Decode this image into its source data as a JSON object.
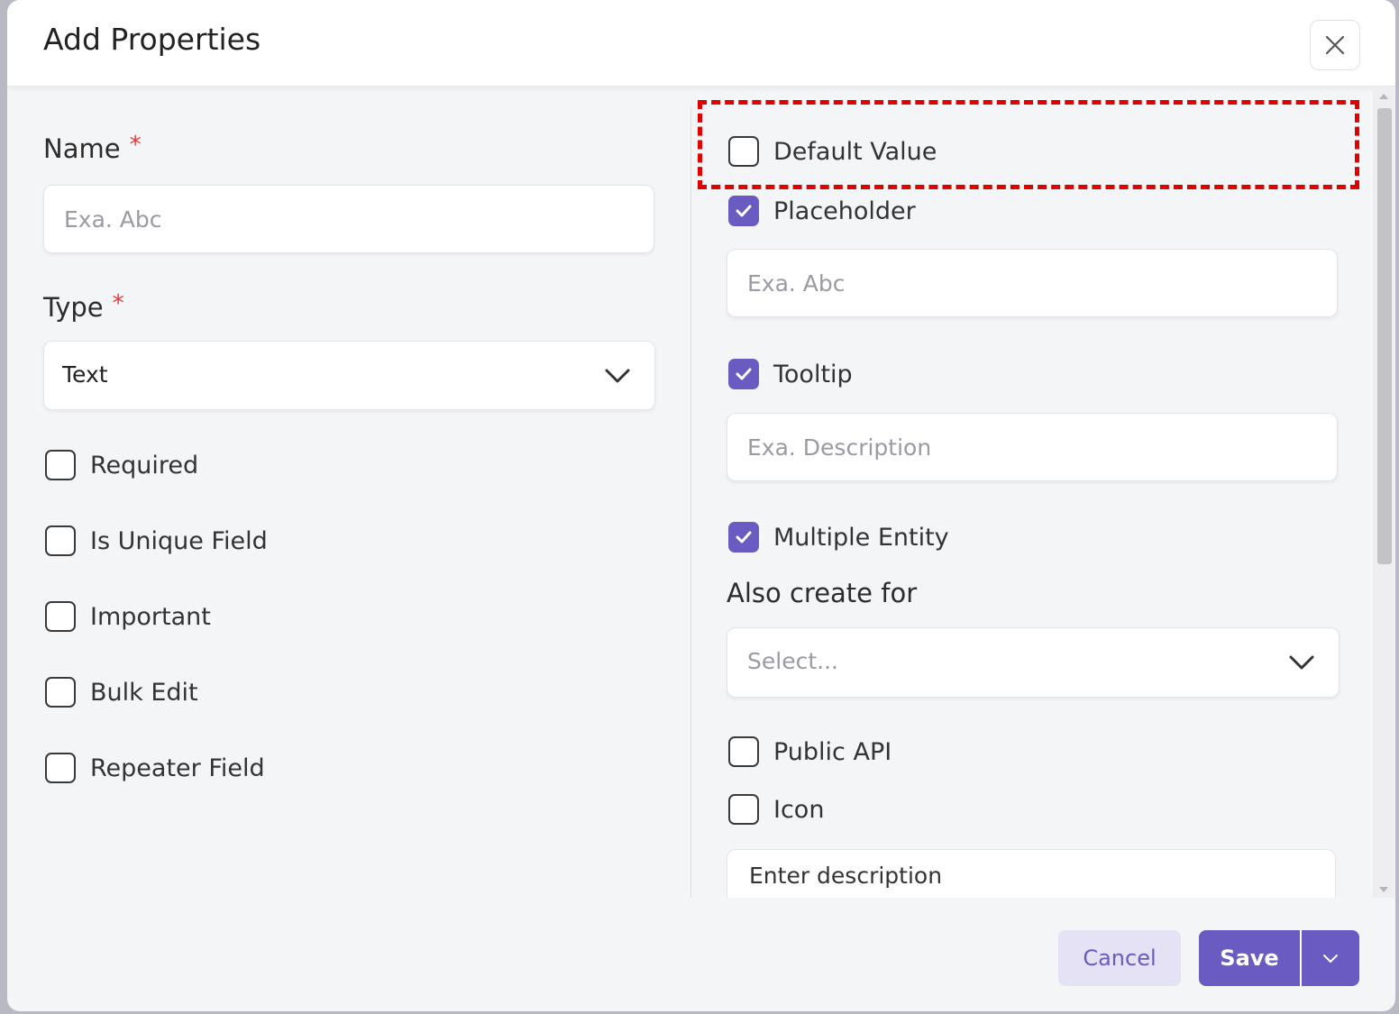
{
  "dialog": {
    "title": "Add Properties"
  },
  "left": {
    "name_label": "Name",
    "name_required": "*",
    "name_placeholder": "Exa. Abc",
    "type_label": "Type",
    "type_required": "*",
    "type_value": "Text",
    "options": [
      {
        "label": "Required",
        "checked": false
      },
      {
        "label": "Is Unique Field",
        "checked": false
      },
      {
        "label": "Important",
        "checked": false
      },
      {
        "label": "Bulk Edit",
        "checked": false
      },
      {
        "label": "Repeater Field",
        "checked": false
      }
    ]
  },
  "right": {
    "default_value": {
      "label": "Default Value",
      "checked": false
    },
    "placeholder": {
      "label": "Placeholder",
      "checked": true,
      "input_placeholder": "Exa. Abc"
    },
    "tooltip": {
      "label": "Tooltip",
      "checked": true,
      "input_placeholder": "Exa. Description"
    },
    "multiple_entity": {
      "label": "Multiple Entity",
      "checked": true
    },
    "also_create_for": {
      "label": "Also create for",
      "placeholder": "Select..."
    },
    "public_api": {
      "label": "Public API",
      "checked": false
    },
    "icon": {
      "label": "Icon",
      "checked": false
    },
    "description_text": "Enter description"
  },
  "footer": {
    "cancel_label": "Cancel",
    "save_label": "Save"
  },
  "colors": {
    "accent": "#6a5bc2",
    "highlight": "#e00000",
    "required_star": "#e03a3a"
  }
}
